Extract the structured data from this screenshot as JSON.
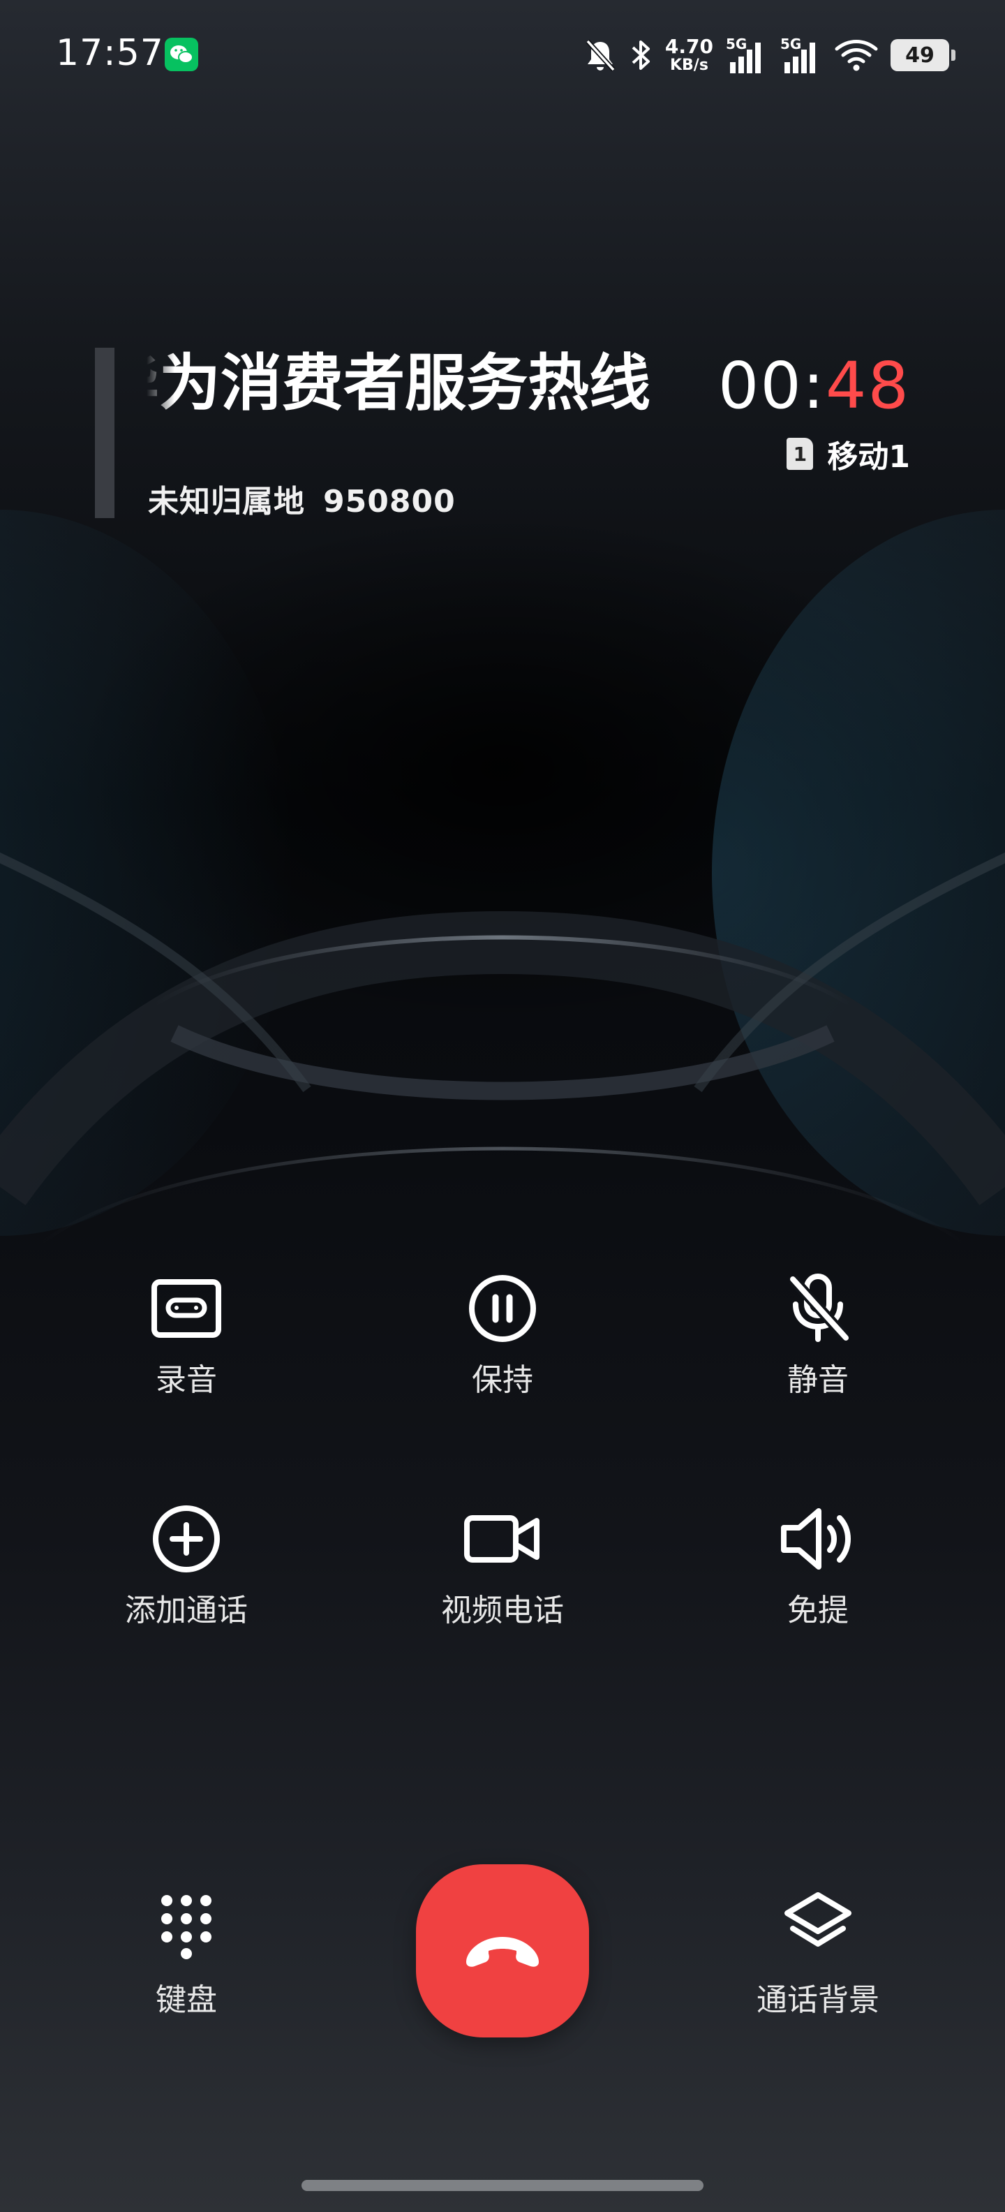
{
  "status_bar": {
    "time": "17:57",
    "net_speed_value": "4.70",
    "net_speed_unit": "KB/s",
    "sim1_label": "5G",
    "sim2_label": "5G",
    "battery_level": "49"
  },
  "call": {
    "caller_name": "华为消费者服务热线",
    "location": "未知归属地",
    "number": "950800",
    "timer_minutes": "00:",
    "timer_seconds": "48",
    "sim_badge": "1",
    "carrier": "移动1"
  },
  "controls": {
    "record": "录音",
    "hold": "保持",
    "mute": "静音",
    "add_call": "添加通话",
    "video_call": "视频电话",
    "speaker": "免提"
  },
  "bottom": {
    "keypad": "键盘",
    "call_background": "通话背景"
  },
  "colors": {
    "accent_red": "#f04141",
    "timer_seconds": "#ff4b4b",
    "wechat_green": "#07c160"
  }
}
